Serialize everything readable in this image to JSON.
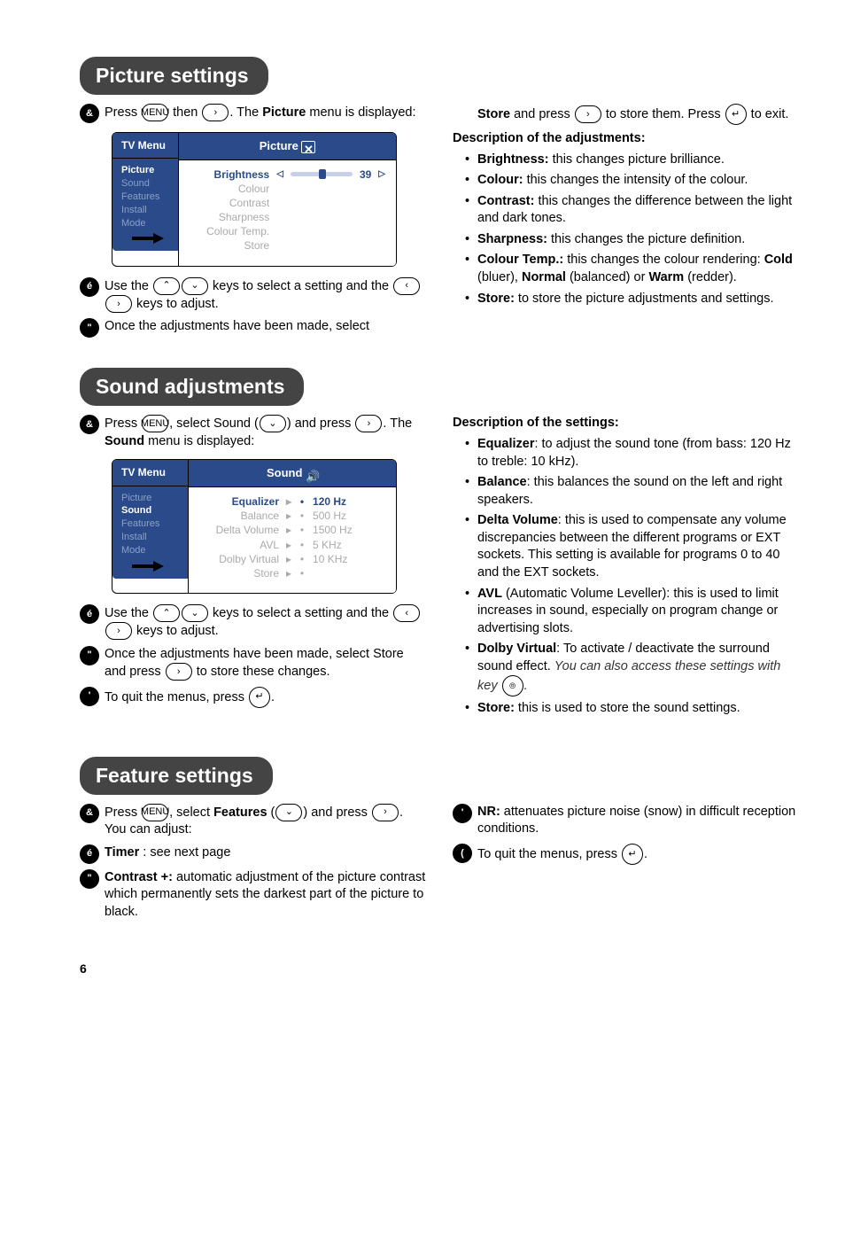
{
  "pageNumber": "6",
  "section1": {
    "title": "Picture settings",
    "step1_a": "Press ",
    "step1_b": " then ",
    "step1_c": ". The ",
    "step1_bold": "Picture",
    "step1_d": " menu is displayed:",
    "step2_a": "Use the ",
    "step2_b": " keys to select a setting and the ",
    "step2_c": " keys to adjust.",
    "step3": "Once the adjustments have been made, select ",
    "right_top_a": "Store",
    "right_top_b": " and press ",
    "right_top_c": " to store them. Press ",
    "right_top_d": " to exit.",
    "desc_heading": "Description of the adjustments:",
    "items": [
      {
        "label": "Brightness:",
        "text": " this changes picture brilliance."
      },
      {
        "label": "Colour:",
        "text": " this changes the intensity of the colour."
      },
      {
        "label": "Contrast:",
        "text": " this changes the difference between the light and dark tones."
      },
      {
        "label": "Sharpness:",
        "text": " this changes the picture definition."
      },
      {
        "label": "Colour Temp.:",
        "text": " this changes the colour rendering: ",
        "sub": "Cold",
        "sub2": " (bluer), ",
        "sub3": "Normal",
        "sub4": " (balanced) or ",
        "sub5": "Warm",
        "sub6": " (redder)."
      },
      {
        "label": "Store:",
        "text": " to store the picture adjustments and settings."
      }
    ],
    "tv": {
      "menu_title": "TV Menu",
      "panel_title": "Picture",
      "side": [
        "Picture",
        "Sound",
        "Features",
        "Install",
        "Mode"
      ],
      "body": [
        {
          "label": "Brightness",
          "value": "39",
          "active": true
        },
        {
          "label": "Colour"
        },
        {
          "label": "Contrast"
        },
        {
          "label": "Sharpness"
        },
        {
          "label": "Colour Temp."
        },
        {
          "label": "Store"
        }
      ]
    }
  },
  "section2": {
    "title": "Sound adjustments",
    "step1_a": "Press ",
    "step1_b": ", select Sound (",
    "step1_c": ") and press ",
    "step1_d": ". The ",
    "step1_bold": "Sound",
    "step1_e": " menu is displayed:",
    "step2_a": "Use the ",
    "step2_b": " keys to select a setting and the ",
    "step2_c": " keys to adjust.",
    "step3_a": "Once the adjustments have been made, select Store and press ",
    "step3_b": " to store these changes.",
    "step4_a": "To quit the menus, press ",
    "step4_b": ".",
    "desc_heading": "Description of the settings:",
    "items": [
      {
        "label": "Equalizer",
        "text": ": to adjust the sound tone (from bass: 120 Hz to treble: 10 kHz)."
      },
      {
        "label": "Balance",
        "text": ": this balances the sound on the left and right speakers."
      },
      {
        "label": "Delta Volume",
        "text": ": this is used to compensate any volume discrepancies between the different programs or EXT sockets. This setting is available for programs 0 to 40 and the EXT sockets."
      },
      {
        "label": "AVL",
        "text": " (Automatic Volume Leveller): this is used to limit increases in sound, especially on program change or advertising slots."
      },
      {
        "label": "Dolby Virtual",
        "text": ": To activate / deactivate the surround sound effect. ",
        "ital": "You can also access these settings with key ",
        "ital2": "."
      },
      {
        "label": "Store:",
        "text": " this is used to store the sound settings."
      }
    ],
    "tv": {
      "menu_title": "TV Menu",
      "panel_title": "Sound",
      "side": [
        "Picture",
        "Sound",
        "Features",
        "Install",
        "Mode"
      ],
      "body": [
        {
          "label": "Equalizer",
          "col": "120 Hz",
          "active": true
        },
        {
          "label": "Balance",
          "col": "500 Hz"
        },
        {
          "label": "Delta Volume",
          "col": "1500 Hz"
        },
        {
          "label": "AVL",
          "col": "5 KHz"
        },
        {
          "label": "Dolby Virtual",
          "col": "10 KHz"
        },
        {
          "label": "Store",
          "col": ""
        }
      ]
    }
  },
  "section3": {
    "title": "Feature settings",
    "step1_a": "Press ",
    "step1_b": ", select ",
    "step1_bold": "Features",
    "step1_c": " (",
    "step1_d": ") and press ",
    "step1_e": ". You can adjust:",
    "step2_bold": "Timer",
    "step2_a": " : see next page",
    "step3_bold": "Contrast +:",
    "step3_a": " automatic adjustment of the picture contrast which permanently sets the darkest part of the picture to black.",
    "step4_bold": "NR:",
    "step4_a": " attenuates picture noise (snow) in difficult reception conditions.",
    "step5_a": "To quit the menus, press ",
    "step5_b": "."
  },
  "key_labels": {
    "menu": "MENU",
    "right": "›",
    "left": "‹",
    "up": "⌃",
    "down": "⌄",
    "exit": "↵",
    "surround": "⦾"
  }
}
